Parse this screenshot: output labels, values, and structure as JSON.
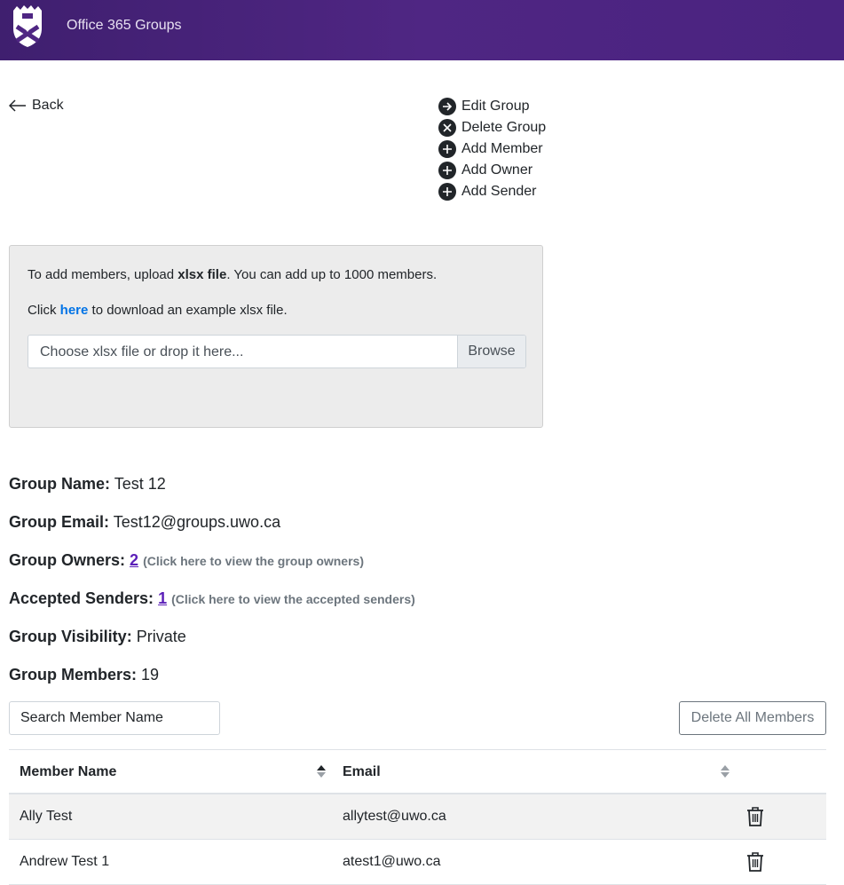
{
  "header": {
    "app_title": "Office 365 Groups"
  },
  "nav": {
    "back_label": "Back"
  },
  "actions": [
    {
      "label": "Edit Group",
      "icon": "arrow-right-circle-icon"
    },
    {
      "label": "Delete Group",
      "icon": "x-circle-icon"
    },
    {
      "label": "Add Member",
      "icon": "plus-circle-icon"
    },
    {
      "label": "Add Owner",
      "icon": "plus-circle-icon"
    },
    {
      "label": "Add Sender",
      "icon": "plus-circle-icon"
    }
  ],
  "upload": {
    "line1_prefix": "To add members, upload ",
    "line1_bold": "xlsx file",
    "line1_suffix": ". You can add up to 1000 members.",
    "line2_prefix": "Click ",
    "line2_link": "here",
    "line2_suffix": " to download an example xlsx file.",
    "file_placeholder": "Choose xlsx file or drop it here...",
    "browse_label": "Browse"
  },
  "group": {
    "name_label": "Group Name:",
    "name_value": "Test 12",
    "email_label": "Group Email:",
    "email_value": "Test12@groups.uwo.ca",
    "owners_label": "Group Owners:",
    "owners_count": "2",
    "owners_hint": "(Click here to view the group owners)",
    "senders_label": "Accepted Senders:",
    "senders_count": "1",
    "senders_hint": "(Click here to view the accepted senders)",
    "visibility_label": "Group Visibility:",
    "visibility_value": "Private",
    "members_label": "Group Members:",
    "members_value": "19"
  },
  "members": {
    "search_placeholder": "Search Member Name",
    "delete_all_label": "Delete All Members",
    "columns": {
      "name": "Member Name",
      "email": "Email"
    },
    "rows": [
      {
        "name": "Ally Test",
        "email": "allytest@uwo.ca"
      },
      {
        "name": "Andrew Test 1",
        "email": "atest1@uwo.ca"
      }
    ]
  },
  "colors": {
    "header_purple": "#4f2683",
    "link_blue": "#0073e6",
    "count_link": "#5b1fb8"
  }
}
